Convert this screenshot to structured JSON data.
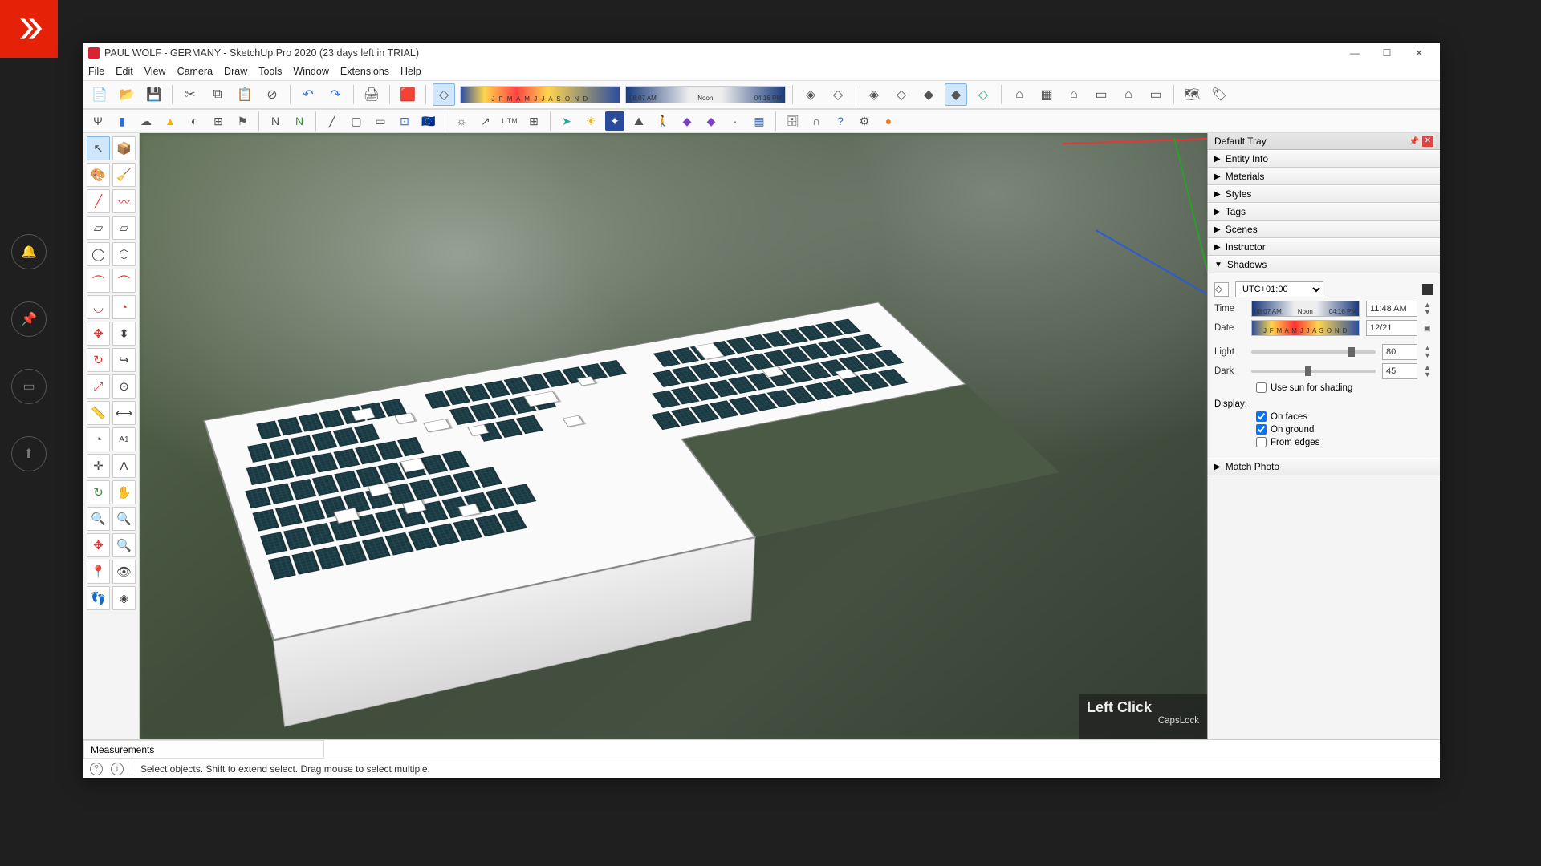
{
  "rail": {
    "icons": [
      "bell",
      "pin",
      "book",
      "upload"
    ]
  },
  "window": {
    "title": "PAUL WOLF - GERMANY - SketchUp Pro 2020 (23 days left in TRIAL)",
    "controls": {
      "min": "—",
      "max": "☐",
      "close": "✕"
    }
  },
  "menubar": [
    "File",
    "Edit",
    "View",
    "Camera",
    "Draw",
    "Tools",
    "Window",
    "Extensions",
    "Help"
  ],
  "toolbar1": {
    "group_file": [
      "new",
      "open",
      "save"
    ],
    "group_edit": [
      "cut",
      "copy",
      "paste",
      "delete"
    ],
    "group_undo": [
      "undo",
      "redo"
    ],
    "group_print": [
      "print",
      "model-info"
    ],
    "active_cube": true
  },
  "date_strip": {
    "months": "J F M A M J J A S O N D"
  },
  "time_strip": {
    "start": "08:07 AM",
    "noon": "Noon",
    "end": "04:16 PM"
  },
  "tray": {
    "title": "Default Tray",
    "sections": [
      "Entity Info",
      "Materials",
      "Styles",
      "Tags",
      "Scenes",
      "Instructor",
      "Shadows",
      "Match Photo"
    ],
    "shadows": {
      "timezone": "UTC+01:00",
      "time_label": "Time",
      "time_start": "08:07 AM",
      "time_noon": "Noon",
      "time_end": "04:16 PM",
      "time_value": "11:48 AM",
      "date_label": "Date",
      "date_months": "J F M A M J J A S O N D",
      "date_value": "12/21",
      "light_label": "Light",
      "light_value": "80",
      "dark_label": "Dark",
      "dark_value": "45",
      "use_sun": "Use sun for shading",
      "display_label": "Display:",
      "on_faces": "On faces",
      "on_ground": "On ground",
      "from_edges": "From edges"
    }
  },
  "hud": {
    "main": "Left Click",
    "sub": "CapsLock"
  },
  "status": {
    "measurements": "Measurements",
    "hint": "Select objects. Shift to extend select. Drag mouse to select multiple."
  }
}
